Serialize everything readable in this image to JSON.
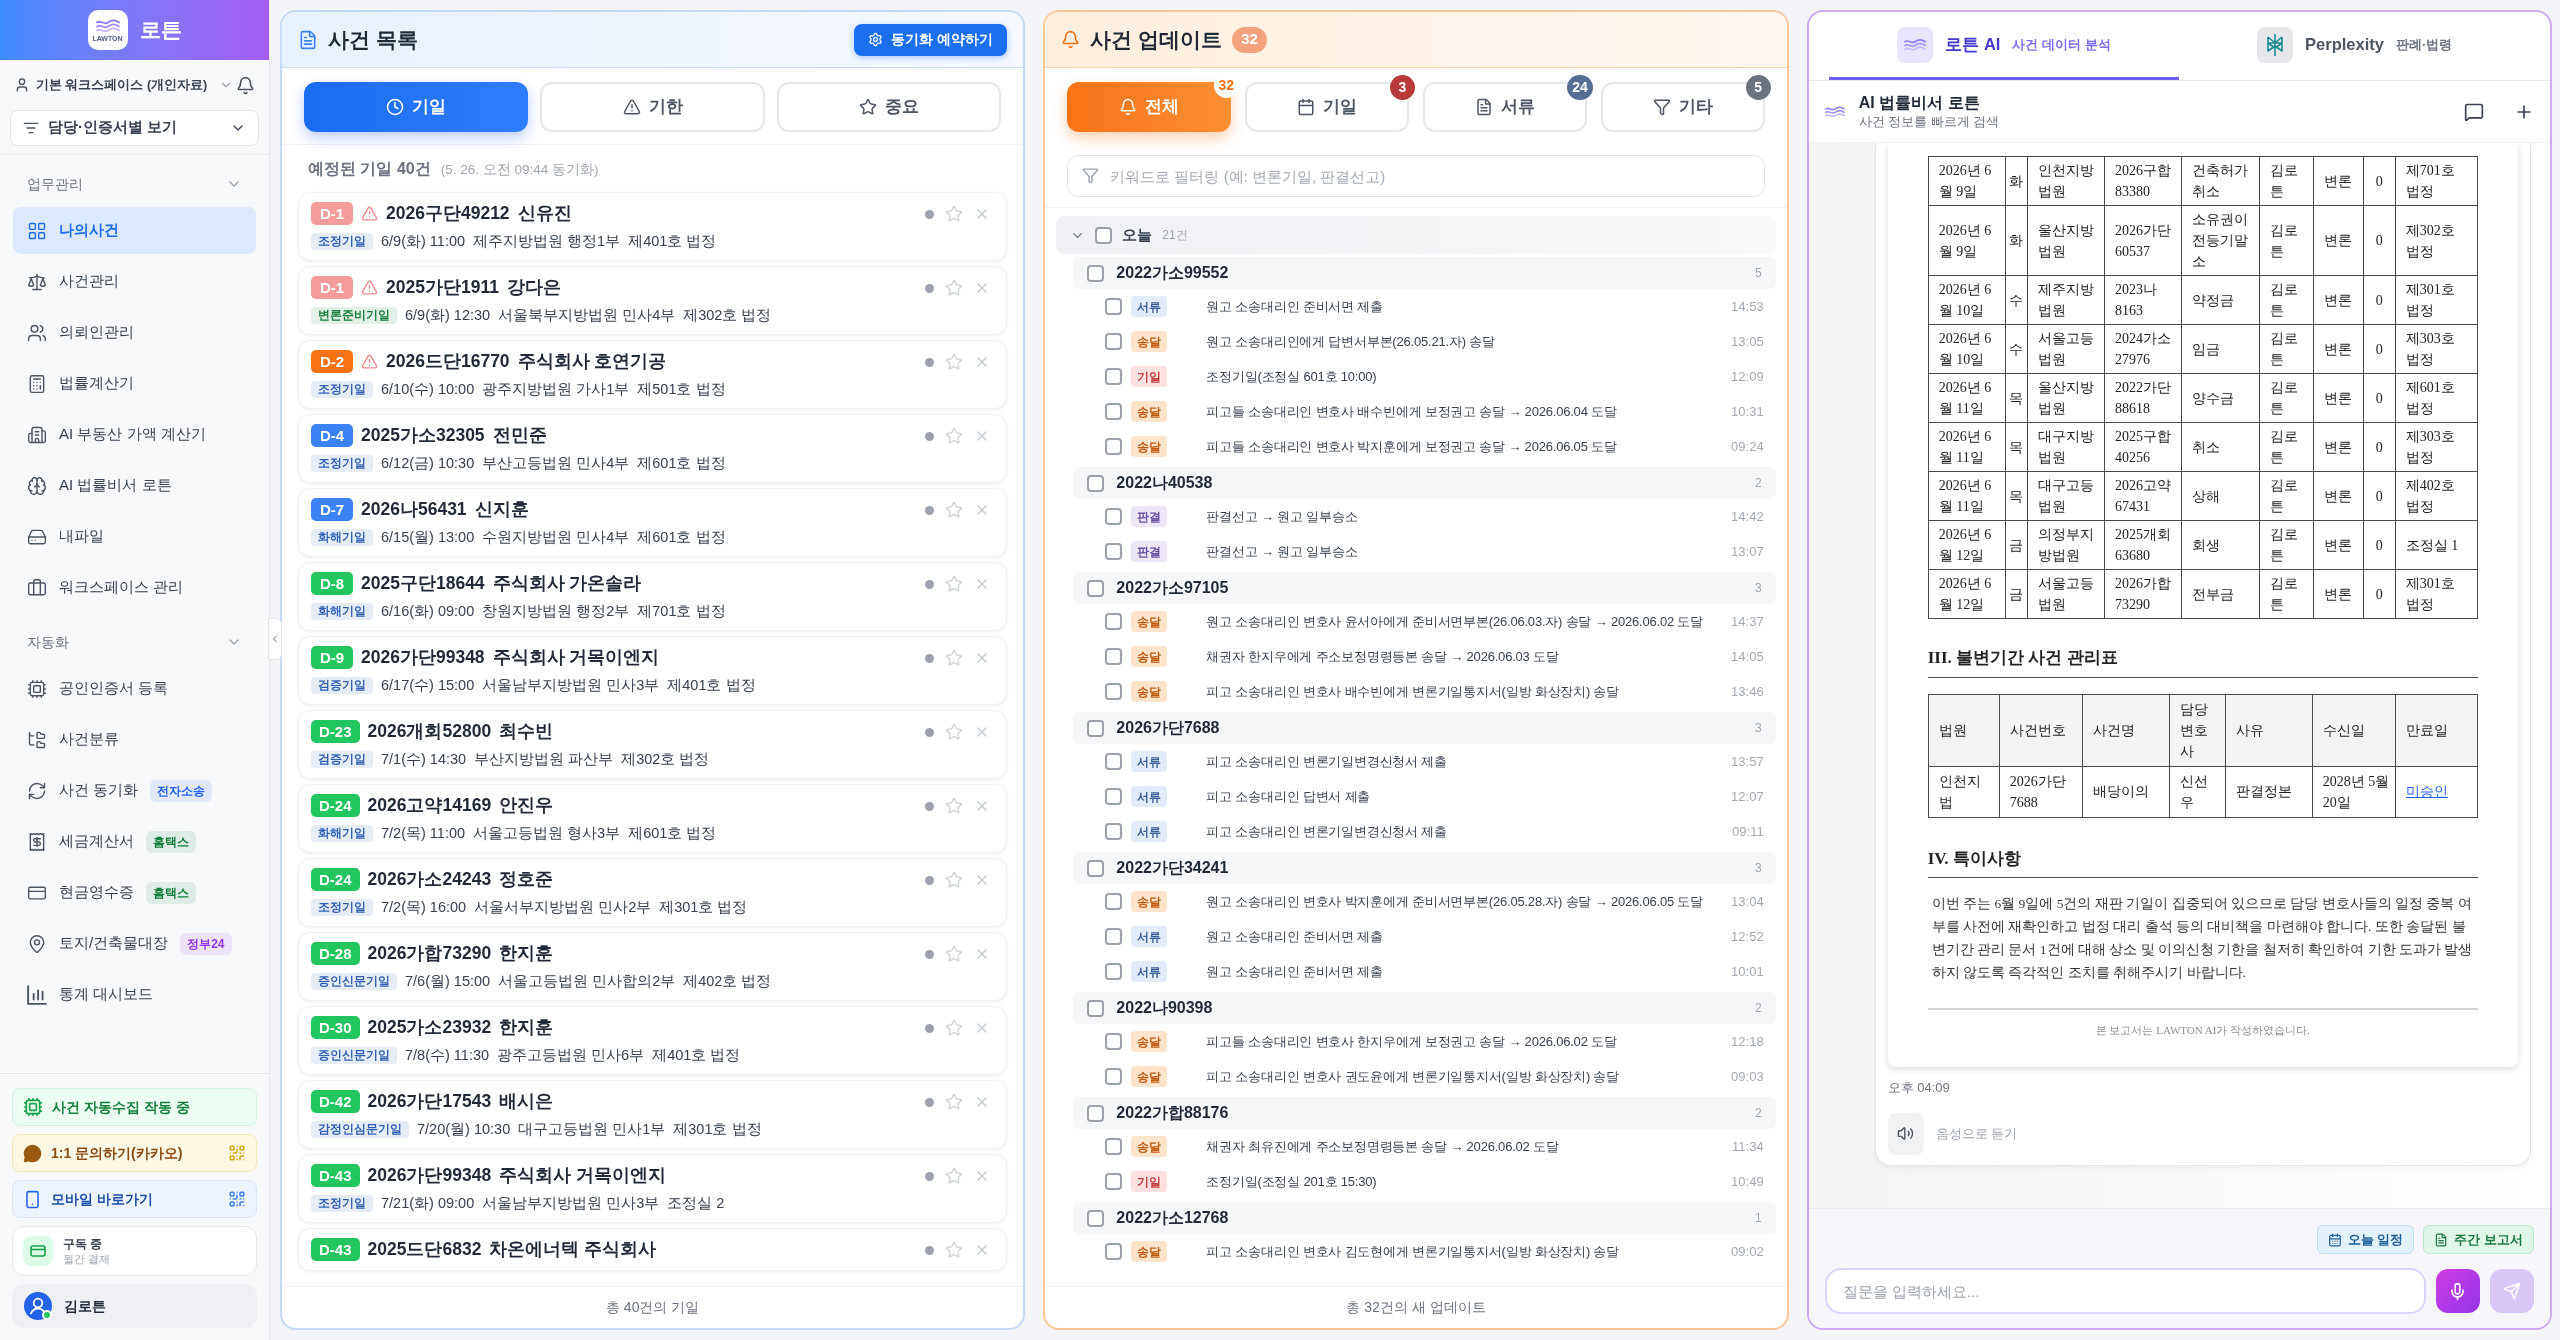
{
  "sidebar": {
    "brand": "로튼",
    "logo_text": "LAWTON",
    "workspace": "기본 워크스페이스 (개인자료)",
    "view_filter": "담당·인증서별 보기",
    "sections": [
      {
        "title": "업무관리",
        "expanded": true,
        "items": [
          {
            "label": "나의사건",
            "selected": true
          },
          {
            "label": "사건관리",
            "selected": false
          },
          {
            "label": "의뢰인관리",
            "selected": false
          },
          {
            "label": "법률계산기",
            "selected": false
          },
          {
            "label": "AI 부동산 가액 계산기",
            "selected": false
          },
          {
            "label": "AI 법률비서 로튼",
            "selected": false
          },
          {
            "label": "내파일",
            "selected": false
          },
          {
            "label": "워크스페이스 관리",
            "selected": false
          }
        ]
      },
      {
        "title": "자동화",
        "expanded": true,
        "items": [
          {
            "label": "공인인증서 등록",
            "selected": false
          },
          {
            "label": "사건분류",
            "selected": false
          },
          {
            "label": "사건 동기화",
            "selected": false,
            "badge": {
              "label": "전자소송",
              "color": "#2563eb"
            }
          },
          {
            "label": "세금계산서",
            "selected": false,
            "badge": {
              "label": "홈택스",
              "color": "#15803d"
            }
          },
          {
            "label": "현금영수증",
            "selected": false,
            "badge": {
              "label": "홈택스",
              "color": "#15803d"
            }
          },
          {
            "label": "토지/건축물대장",
            "selected": false,
            "badge": {
              "label": "정부24",
              "color": "#9333ea"
            }
          },
          {
            "label": "통계 대시보드",
            "selected": false
          }
        ]
      }
    ],
    "status": "사건 자동수집 작동 중",
    "links": [
      {
        "label": "1:1 문의하기(카카오)",
        "kind": "kakao"
      },
      {
        "label": "모바일 바로가기",
        "kind": "mobile"
      }
    ],
    "subscription": {
      "title": "구독 중",
      "plan": "월간 결제"
    },
    "user": {
      "name": "김로튼",
      "online": true
    }
  },
  "case_list": {
    "title": "사건 목록",
    "sync_button": "동기화 예약하기",
    "tabs": [
      {
        "label": "기일",
        "selected": true
      },
      {
        "label": "기한",
        "selected": false
      },
      {
        "label": "중요",
        "selected": false
      }
    ],
    "summary": "예정된 기일 40건",
    "synced_at": "(5. 26. 오전 09:44 동기화)",
    "cards": [
      {
        "d_day": {
          "label": "D-1",
          "color": "#f49b9b"
        },
        "warning": true,
        "case_no": "2026구단49212",
        "party": "신유진",
        "type": {
          "label": "조정기일",
          "color": "#2f5fb3"
        },
        "when": "6/9(화) 11:00",
        "court": "제주지방법원 행정1부",
        "room": "제401호 법정",
        "starred": false
      },
      {
        "d_day": {
          "label": "D-1",
          "color": "#f49b9b"
        },
        "warning": true,
        "case_no": "2025가단1911",
        "party": "강다은",
        "type": {
          "label": "변론준비기일",
          "color": "#15803d"
        },
        "when": "6/9(화) 12:30",
        "court": "서울북부지방법원 민사4부",
        "room": "제302호 법정",
        "starred": false
      },
      {
        "d_day": {
          "label": "D-2",
          "color": "#f97316"
        },
        "warning": true,
        "case_no": "2026드단16770",
        "party": "주식회사 호연기공",
        "type": {
          "label": "조정기일",
          "color": "#2f5fb3"
        },
        "when": "6/10(수) 10:00",
        "court": "광주지방법원 가사1부",
        "room": "제501호 법정",
        "starred": false
      },
      {
        "d_day": {
          "label": "D-4",
          "color": "#3b82f6"
        },
        "warning": false,
        "case_no": "2025가소32305",
        "party": "전민준",
        "type": {
          "label": "조정기일",
          "color": "#2f5fb3"
        },
        "when": "6/12(금) 10:30",
        "court": "부산고등법원 민사4부",
        "room": "제601호 법정",
        "starred": false
      },
      {
        "d_day": {
          "label": "D-7",
          "color": "#3b82f6"
        },
        "warning": false,
        "case_no": "2026나56431",
        "party": "신지훈",
        "type": {
          "label": "화해기일",
          "color": "#2f5fb3"
        },
        "when": "6/15(월) 13:00",
        "court": "수원지방법원 민사4부",
        "room": "제601호 법정",
        "starred": false
      },
      {
        "d_day": {
          "label": "D-8",
          "color": "#22c55e"
        },
        "warning": false,
        "case_no": "2025구단18644",
        "party": "주식회사 가온솔라",
        "type": {
          "label": "화해기일",
          "color": "#2f5fb3"
        },
        "when": "6/16(화) 09:00",
        "court": "창원지방법원 행정2부",
        "room": "제701호 법정",
        "starred": false
      },
      {
        "d_day": {
          "label": "D-9",
          "color": "#22c55e"
        },
        "warning": false,
        "case_no": "2026가단99348",
        "party": "주식회사 거목이엔지",
        "type": {
          "label": "검증기일",
          "color": "#2f5fb3"
        },
        "when": "6/17(수) 15:00",
        "court": "서울남부지방법원 민사3부",
        "room": "제401호 법정",
        "starred": false
      },
      {
        "d_day": {
          "label": "D-23",
          "color": "#22c55e"
        },
        "warning": false,
        "case_no": "2026개회52800",
        "party": "최수빈",
        "type": {
          "label": "검증기일",
          "color": "#2f5fb3"
        },
        "when": "7/1(수) 14:30",
        "court": "부산지방법원 파산부",
        "room": "제302호 법정",
        "starred": false
      },
      {
        "d_day": {
          "label": "D-24",
          "color": "#22c55e"
        },
        "warning": false,
        "case_no": "2026고약14169",
        "party": "안진우",
        "type": {
          "label": "화해기일",
          "color": "#2f5fb3"
        },
        "when": "7/2(목) 11:00",
        "court": "서울고등법원 형사3부",
        "room": "제601호 법정",
        "starred": false
      },
      {
        "d_day": {
          "label": "D-24",
          "color": "#22c55e"
        },
        "warning": false,
        "case_no": "2026가소24243",
        "party": "정호준",
        "type": {
          "label": "조정기일",
          "color": "#2f5fb3"
        },
        "when": "7/2(목) 16:00",
        "court": "서울서부지방법원 민사2부",
        "room": "제301호 법정",
        "starred": false
      },
      {
        "d_day": {
          "label": "D-28",
          "color": "#22c55e"
        },
        "warning": false,
        "case_no": "2026가합73290",
        "party": "한지훈",
        "type": {
          "label": "증인신문기일",
          "color": "#2f5fb3"
        },
        "when": "7/6(월) 15:00",
        "court": "서울고등법원 민사합의2부",
        "room": "제402호 법정",
        "starred": false
      },
      {
        "d_day": {
          "label": "D-30",
          "color": "#22c55e"
        },
        "warning": false,
        "case_no": "2025가소23932",
        "party": "한지훈",
        "type": {
          "label": "증인신문기일",
          "color": "#2f5fb3"
        },
        "when": "7/8(수) 11:30",
        "court": "광주고등법원 민사6부",
        "room": "제401호 법정",
        "starred": false
      },
      {
        "d_day": {
          "label": "D-42",
          "color": "#22c55e"
        },
        "warning": false,
        "case_no": "2026가단17543",
        "party": "배시은",
        "type": {
          "label": "감정인심문기일",
          "color": "#2f5fb3"
        },
        "when": "7/20(월) 10:30",
        "court": "대구고등법원 민사1부",
        "room": "제301호 법정",
        "starred": false
      },
      {
        "d_day": {
          "label": "D-43",
          "color": "#22c55e"
        },
        "warning": false,
        "case_no": "2026가단99348",
        "party": "주식회사 거목이엔지",
        "type": {
          "label": "조정기일",
          "color": "#2f5fb3"
        },
        "when": "7/21(화) 09:00",
        "court": "서울남부지방법원 민사3부",
        "room": "조정실 2",
        "starred": false
      },
      {
        "d_day": {
          "label": "D-43",
          "color": "#22c55e"
        },
        "warning": false,
        "case_no": "2025드단6832",
        "party": "차온에너텍 주식회사",
        "starred": false
      }
    ],
    "footer": "총 40건의 기일"
  },
  "updates": {
    "title": "사건 업데이트",
    "count": "32",
    "tabs": [
      {
        "label": "전체",
        "count": "32",
        "selected": true,
        "color": "#f97316"
      },
      {
        "label": "기일",
        "count": "3",
        "selected": false,
        "color": "#b83a3a"
      },
      {
        "label": "서류",
        "count": "24",
        "selected": false,
        "color": "#566d94"
      },
      {
        "label": "기타",
        "count": "5",
        "selected": false,
        "color": "#6b7280"
      }
    ],
    "filter": {
      "placeholder": "키워드로 필터링 (예: 변론기일, 판결선고)"
    },
    "groups": [
      {
        "label": "오늘",
        "count": "21건",
        "expanded": true,
        "checked": false,
        "cases": [
          {
            "case_no": "2022가소99552",
            "count": "5",
            "checked": false,
            "items": [
              {
                "kind": "document",
                "tag": "서류",
                "text": "원고 소송대리인 준비서면 제출",
                "time": "14:53",
                "checked": false
              },
              {
                "kind": "delivery",
                "tag": "송달",
                "text": "원고 소송대리인에게 답변서부본(26.05.21.자) 송달",
                "time": "13:05",
                "checked": false
              },
              {
                "kind": "hearing",
                "tag": "기일",
                "text": "조정기일(조정실 601호 10:00)",
                "time": "12:09",
                "checked": false
              },
              {
                "kind": "delivery",
                "tag": "송달",
                "text": "피고들 소송대리인 변호사 배수빈에게 보정권고 송달 → 2026.06.04 도달",
                "time": "10:31",
                "checked": false
              },
              {
                "kind": "delivery",
                "tag": "송달",
                "text": "피고들 소송대리인 변호사 박지훈에게 보정권고 송달 → 2026.06.05 도달",
                "time": "09:24",
                "checked": false
              }
            ]
          },
          {
            "case_no": "2022나40538",
            "count": "2",
            "checked": false,
            "items": [
              {
                "kind": "ruling",
                "tag": "판결",
                "text": "판결선고 → 원고 일부승소",
                "time": "14:42",
                "checked": false
              },
              {
                "kind": "ruling",
                "tag": "판결",
                "text": "판결선고 → 원고 일부승소",
                "time": "13:07",
                "checked": false
              }
            ]
          },
          {
            "case_no": "2022가소97105",
            "count": "3",
            "checked": false,
            "items": [
              {
                "kind": "delivery",
                "tag": "송달",
                "text": "원고 소송대리인 변호사 윤서아에게 준비서면부본(26.06.03.자) 송달 → 2026.06.02 도달",
                "time": "14:37",
                "checked": false
              },
              {
                "kind": "delivery",
                "tag": "송달",
                "text": "채권자 한지우에게 주소보정명령등본 송달 → 2026.06.03 도달",
                "time": "14:05",
                "checked": false
              },
              {
                "kind": "delivery",
                "tag": "송달",
                "text": "피고 소송대리인 변호사 배수빈에게 변론기일통지서(일방 화상장치) 송달",
                "time": "13:46",
                "checked": false
              }
            ]
          },
          {
            "case_no": "2026가단7688",
            "count": "3",
            "checked": false,
            "items": [
              {
                "kind": "document",
                "tag": "서류",
                "text": "피고 소송대리인 변론기일변경신청서 제출",
                "time": "13:57",
                "checked": false
              },
              {
                "kind": "document",
                "tag": "서류",
                "text": "피고 소송대리인 답변서 제출",
                "time": "12:07",
                "checked": false
              },
              {
                "kind": "document",
                "tag": "서류",
                "text": "피고 소송대리인 변론기일변경신청서 제출",
                "time": "09:11",
                "checked": false
              }
            ]
          },
          {
            "case_no": "2022가단34241",
            "count": "3",
            "checked": false,
            "items": [
              {
                "kind": "delivery",
                "tag": "송달",
                "text": "원고 소송대리인 변호사 박지훈에게 준비서면부본(26.05.28.자) 송달 → 2026.06.05 도달",
                "time": "13:04",
                "checked": false
              },
              {
                "kind": "document",
                "tag": "서류",
                "text": "원고 소송대리인 준비서면 제출",
                "time": "12:52",
                "checked": false
              },
              {
                "kind": "document",
                "tag": "서류",
                "text": "원고 소송대리인 준비서면 제출",
                "time": "10:01",
                "checked": false
              }
            ]
          },
          {
            "case_no": "2022나90398",
            "count": "2",
            "checked": false,
            "items": [
              {
                "kind": "delivery",
                "tag": "송달",
                "text": "피고들 소송대리인 변호사 한지우에게 보정권고 송달 → 2026.06.02 도달",
                "time": "12:18",
                "checked": false
              },
              {
                "kind": "delivery",
                "tag": "송달",
                "text": "피고 소송대리인 변호사 권도윤에게 변론기일통지서(일방 화상장치) 송달",
                "time": "09:03",
                "checked": false
              }
            ]
          },
          {
            "case_no": "2022가합88176",
            "count": "2",
            "checked": false,
            "items": [
              {
                "kind": "delivery",
                "tag": "송달",
                "text": "채권자 최유진에게 주소보정명령등본 송달 → 2026.06.02 도달",
                "time": "11:34",
                "checked": false
              },
              {
                "kind": "hearing",
                "tag": "기일",
                "text": "조정기일(조정실 201호 15:30)",
                "time": "10:49",
                "checked": false
              }
            ]
          },
          {
            "case_no": "2022가소12768",
            "count": "1",
            "checked": false,
            "items": [
              {
                "kind": "delivery",
                "tag": "송달",
                "text": "피고 소송대리인 변호사 김도현에게 변론기일통지서(일방 화상장치) 송달",
                "time": "09:02",
                "checked": false
              }
            ]
          }
        ]
      }
    ],
    "footer": "총 32건의 새 업데이트"
  },
  "assistant": {
    "tabs": [
      {
        "label": "로튼 AI",
        "sub": "사건 데이터 분석",
        "selected": true
      },
      {
        "label": "Perplexity",
        "sub": "판례·법령",
        "selected": false
      }
    ],
    "chat": {
      "title": "AI 법률비서 로튼",
      "subtitle": "사건 정보를 빠르게 검색"
    },
    "report": {
      "hearings": {
        "rows": [
          [
            "2026년 6월 9일",
            "화",
            "인천지방법원",
            "2026구합83380",
            "건축허가취소",
            "김로튼",
            "변론",
            "0",
            "제701호 법정"
          ],
          [
            "2026년 6월 9일",
            "화",
            "울산지방법원",
            "2026가단60537",
            "소유권이전등기말소",
            "김로튼",
            "변론",
            "0",
            "제302호 법정"
          ],
          [
            "2026년 6월 10일",
            "수",
            "제주지방법원",
            "2023나8163",
            "약정금",
            "김로튼",
            "변론",
            "0",
            "제301호 법정"
          ],
          [
            "2026년 6월 10일",
            "수",
            "서울고등법원",
            "2024가소27976",
            "임금",
            "김로튼",
            "변론",
            "0",
            "제303호 법정"
          ],
          [
            "2026년 6월 11일",
            "목",
            "울산지방법원",
            "2022가단88618",
            "양수금",
            "김로튼",
            "변론",
            "0",
            "제601호 법정"
          ],
          [
            "2026년 6월 11일",
            "목",
            "대구지방법원",
            "2025구합40256",
            "취소",
            "김로튼",
            "변론",
            "0",
            "제303호 법정"
          ],
          [
            "2026년 6월 11일",
            "목",
            "대구고등법원",
            "2026고약67431",
            "상해",
            "김로튼",
            "변론",
            "0",
            "제402호 법정"
          ],
          [
            "2026년 6월 12일",
            "금",
            "의정부지방법원",
            "2025개회63680",
            "회생",
            "김로튼",
            "변론",
            "0",
            "조정실 1"
          ],
          [
            "2026년 6월 12일",
            "금",
            "서울고등법원",
            "2026가합73290",
            "전부금",
            "김로튼",
            "변론",
            "0",
            "제301호 법정"
          ]
        ]
      },
      "deadlines": {
        "heading": "III. 불변기간 사건 관리표",
        "columns": [
          "법원",
          "사건번호",
          "사건명",
          "담당변호사",
          "사유",
          "수신일",
          "만료일"
        ],
        "rows": [
          [
            "인천지법",
            "2026가단7688",
            "배당이의",
            "신선우",
            "판결정본",
            "2028년 5월 20일",
            "미승인"
          ]
        ]
      },
      "notes": {
        "heading": "IV. 특이사항",
        "text": "이번 주는 6월 9일에 5건의 재판 기일이 집중되어 있으므로 담당 변호사들의 일정 중복 여부를 사전에 재확인하고 법정 대리 출석 등의 대비책을 마련해야 합니다. 또한 송달된 불변기간 관리 문서 1건에 대해 상소 및 이의신청 기한을 철저히 확인하여 기한 도과가 발생하지 않도록 즉각적인 조치를 취해주시기 바랍니다."
      },
      "footnote": "본 보고서는 LAWTON AI가 작성하였습니다."
    },
    "time": "오후 04:09",
    "listen": "음성으로 듣기",
    "quick_actions": [
      {
        "label": "오늘 일정",
        "kind": "today"
      },
      {
        "label": "주간 보고서",
        "kind": "weekly"
      }
    ],
    "input": {
      "placeholder": "질문을 입력하세요..."
    },
    "send": {
      "disabled": true
    }
  }
}
